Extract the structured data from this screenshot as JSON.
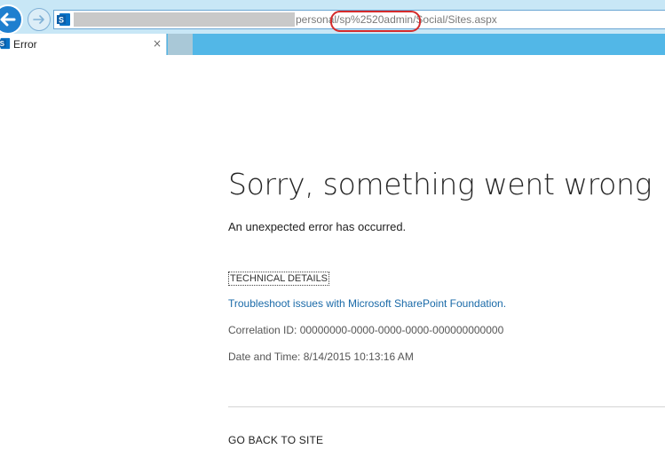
{
  "browser": {
    "address": {
      "url_visible": "personal/sp%2520admin/Social/Sites.aspx",
      "highlight_color": "#d42b2b"
    },
    "tab": {
      "title": "Error",
      "close_glyph": "×"
    },
    "icons": {
      "back": "back-arrow-icon",
      "forward": "forward-arrow-icon",
      "site": "sharepoint-icon"
    }
  },
  "page": {
    "title": "Sorry, something went wrong",
    "subtitle": "An unexpected error has occurred.",
    "technical_details_label": "TECHNICAL DETAILS",
    "troubleshoot_link": "Troubleshoot issues with Microsoft SharePoint Foundation.",
    "correlation_id": "Correlation ID: 00000000-0000-0000-0000-000000000000",
    "date_time": "Date and Time: 8/14/2015 10:13:16 AM",
    "go_back_label": "GO BACK TO SITE",
    "link_color": "#1a6aa8"
  }
}
